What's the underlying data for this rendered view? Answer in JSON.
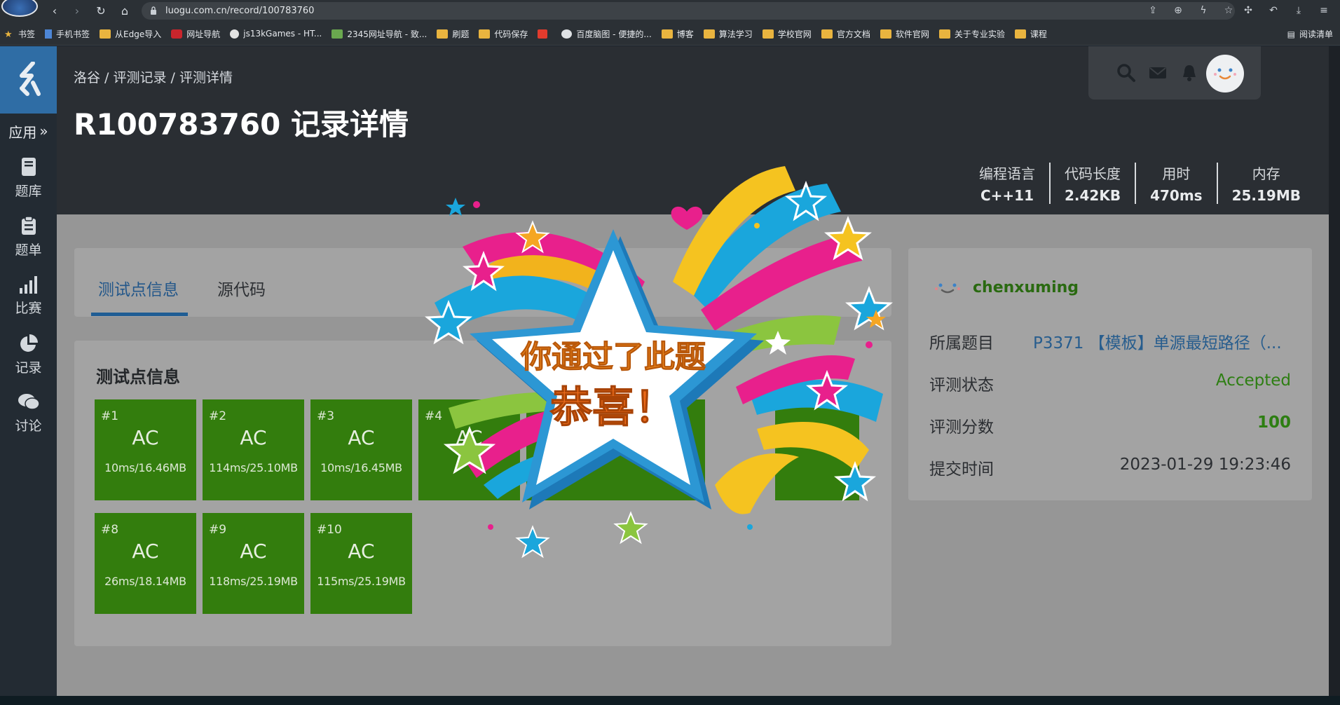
{
  "browser": {
    "url": "luogu.com.cn/record/100783760",
    "bookmarks": [
      {
        "label": "书签",
        "icon": "star-icon"
      },
      {
        "label": "手机书签",
        "icon": "phone-icon"
      },
      {
        "label": "从Edge导入",
        "icon": "folder-icon"
      },
      {
        "label": "网址导航",
        "icon": "site-icon"
      },
      {
        "label": "js13kGames - HT...",
        "icon": "site-icon"
      },
      {
        "label": "2345网址导航 - 致...",
        "icon": "site-icon"
      },
      {
        "label": "刷题",
        "icon": "folder-icon"
      },
      {
        "label": "代码保存",
        "icon": "folder-icon"
      },
      {
        "label": "",
        "icon": "site-icon"
      },
      {
        "label": "百度脑图 - 便捷的...",
        "icon": "site-icon"
      },
      {
        "label": "博客",
        "icon": "folder-icon"
      },
      {
        "label": "算法学习",
        "icon": "folder-icon"
      },
      {
        "label": "学校官网",
        "icon": "folder-icon"
      },
      {
        "label": "官方文档",
        "icon": "folder-icon"
      },
      {
        "label": "软件官网",
        "icon": "folder-icon"
      },
      {
        "label": "关于专业实验",
        "icon": "folder-icon"
      },
      {
        "label": "课程",
        "icon": "folder-icon"
      }
    ],
    "reading_list": "阅读清单"
  },
  "sidebar": {
    "apps": "应用",
    "items": [
      {
        "label": "题库",
        "icon": "book-icon"
      },
      {
        "label": "题单",
        "icon": "clipboard-icon"
      },
      {
        "label": "比赛",
        "icon": "signal-icon"
      },
      {
        "label": "记录",
        "icon": "pie-icon"
      },
      {
        "label": "讨论",
        "icon": "chat-icon"
      }
    ]
  },
  "header": {
    "breadcrumb": "洛谷 / 评测记录 / 评测详情",
    "title": "R100783760 记录详情",
    "stats": [
      {
        "label": "编程语言",
        "value": "C++11"
      },
      {
        "label": "代码长度",
        "value": "2.42KB"
      },
      {
        "label": "用时",
        "value": "470ms"
      },
      {
        "label": "内存",
        "value": "25.19MB"
      }
    ]
  },
  "tabs": [
    {
      "label": "测试点信息",
      "active": true
    },
    {
      "label": "源代码",
      "active": false
    }
  ],
  "cases_title": "测试点信息",
  "cases": [
    {
      "id": "#1",
      "status": "AC",
      "info": "10ms/16.46MB"
    },
    {
      "id": "#2",
      "status": "AC",
      "info": "114ms/25.10MB"
    },
    {
      "id": "#3",
      "status": "AC",
      "info": "10ms/16.45MB"
    },
    {
      "id": "#4",
      "status": "AC",
      "info": ""
    },
    {
      "id": "#8",
      "status": "AC",
      "info": "26ms/18.14MB"
    },
    {
      "id": "#9",
      "status": "AC",
      "info": "118ms/25.19MB"
    },
    {
      "id": "#10",
      "status": "AC",
      "info": "115ms/25.19MB"
    }
  ],
  "record_info": {
    "username": "chenxuming",
    "rows": [
      {
        "label": "所属题目",
        "value": "P3371 【模板】单源最短路径（..."
      },
      {
        "label": "评测状态",
        "value": "Accepted"
      },
      {
        "label": "评测分数",
        "value": "100"
      },
      {
        "label": "提交时间",
        "value": "2023-01-29 19:23:46"
      }
    ]
  },
  "celebration": {
    "line1": "你通过了此题",
    "line2": "恭喜！"
  },
  "colors": {
    "accent_blue": "#1f5d94",
    "ac_green": "#337d0d",
    "accepted_text": "#2d7e12"
  }
}
